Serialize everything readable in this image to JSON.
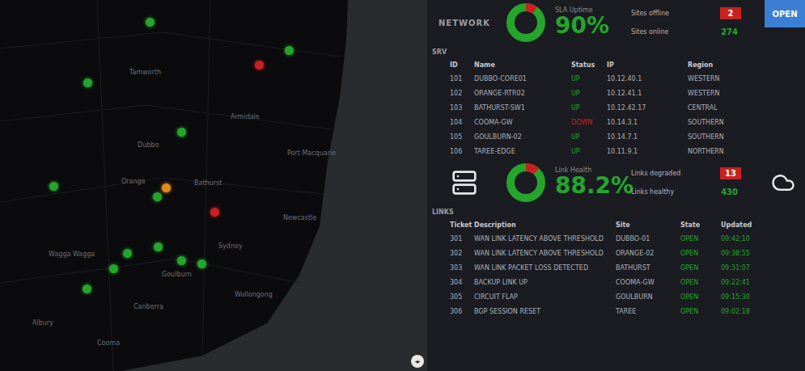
{
  "map": {
    "sites": [
      {
        "status": "up",
        "color": "#25a52c"
      },
      {
        "status": "up",
        "color": "#25a52c"
      },
      {
        "status": "down",
        "color": "#c8211f"
      },
      {
        "status": "up",
        "color": "#25a52c"
      },
      {
        "status": "up",
        "color": "#25a52c"
      },
      {
        "status": "up",
        "color": "#25a52c"
      },
      {
        "status": "up",
        "color": "#25a52c"
      },
      {
        "status": "warning",
        "color": "#e0891e"
      },
      {
        "status": "down",
        "color": "#c8211f"
      },
      {
        "status": "up",
        "color": "#25a52c"
      },
      {
        "status": "up",
        "color": "#25a52c"
      },
      {
        "status": "up",
        "color": "#25a52c"
      },
      {
        "status": "up",
        "color": "#25a52c"
      },
      {
        "status": "up",
        "color": "#25a52c"
      },
      {
        "status": "up",
        "color": "#25a52c"
      }
    ],
    "labels": [
      "Tamworth",
      "Armidale",
      "Dubbo",
      "Port Macquarie",
      "Orange",
      "Bathurst",
      "Newcastle",
      "Sydney",
      "Wagga Wagga",
      "Goulburn",
      "Canberra",
      "Wollongong",
      "Albury",
      "Cooma"
    ],
    "reset": "⌖"
  },
  "sections": [
    {
      "logo": {
        "kind": "text",
        "text": "NETWORK"
      },
      "title": "SLA Uptime",
      "value": "90%",
      "level": 0.9,
      "counters": [
        {
          "label": "Sites offline",
          "value": "2",
          "color": "#c8211f",
          "kind": "box"
        },
        {
          "label": "Sites online",
          "value": "274",
          "color": "#25a52c",
          "kind": "text"
        }
      ],
      "action": {
        "kind": "button",
        "label": "OPEN"
      },
      "table": {
        "caption": "SRV",
        "columns": [
          "ID",
          "Name",
          "Status",
          "IP",
          "Region"
        ],
        "rows": [
          [
            "101",
            "DUBBO-CORE01",
            "UP",
            "10.12.40.1",
            "WESTERN"
          ],
          [
            "102",
            "ORANGE-RTR02",
            "UP",
            "10.12.41.1",
            "WESTERN"
          ],
          [
            "103",
            "BATHURST-SW1",
            "UP",
            "10.12.42.17",
            "CENTRAL"
          ],
          [
            "104",
            "COOMA-GW",
            "DOWN",
            "10.14.3.1",
            "SOUTHERN"
          ],
          [
            "105",
            "GOULBURN-02",
            "UP",
            "10.14.7.1",
            "SOUTHERN"
          ],
          [
            "106",
            "TAREE-EDGE",
            "UP",
            "10.11.9.1",
            "NORTHERN"
          ]
        ],
        "status_colors": [
          "#25a52c",
          "#25a52c",
          "#25a52c",
          "#c8211f",
          "#25a52c",
          "#25a52c"
        ]
      }
    },
    {
      "logo": {
        "kind": "icon",
        "text": ""
      },
      "title": "Link Health",
      "value": "88.2%",
      "level": 0.882,
      "counters": [
        {
          "label": "Links degraded",
          "value": "13",
          "color": "#c8211f",
          "kind": "box"
        },
        {
          "label": "Links healthy",
          "value": "430",
          "color": "#25a52c",
          "kind": "text"
        }
      ],
      "action": {
        "kind": "icon",
        "label": ""
      },
      "table": {
        "caption": "LINKS",
        "columns": [
          "Ticket",
          "Description",
          "Site",
          "State",
          "Updated"
        ],
        "rows": [
          [
            "301",
            "WAN LINK LATENCY ABOVE THRESHOLD",
            "DUBBO-01",
            "OPEN",
            "09:42:10"
          ],
          [
            "302",
            "WAN LINK LATENCY ABOVE THRESHOLD",
            "ORANGE-02",
            "OPEN",
            "09:38:55"
          ],
          [
            "303",
            "WAN LINK PACKET LOSS DETECTED",
            "BATHURST",
            "OPEN",
            "09:31:07"
          ],
          [
            "304",
            "BACKUP LINK UP",
            "COOMA-GW",
            "OPEN",
            "09:22:41"
          ],
          [
            "305",
            "CIRCUIT FLAP",
            "GOULBURN",
            "OPEN",
            "09:15:30"
          ],
          [
            "306",
            "BGP SESSION RESET",
            "TAREE",
            "OPEN",
            "09:02:18"
          ]
        ],
        "status_colors": [
          "#25a52c",
          "#25a52c",
          "#25a52c",
          "#25a52c",
          "#25a52c",
          "#25a52c"
        ]
      }
    }
  ]
}
